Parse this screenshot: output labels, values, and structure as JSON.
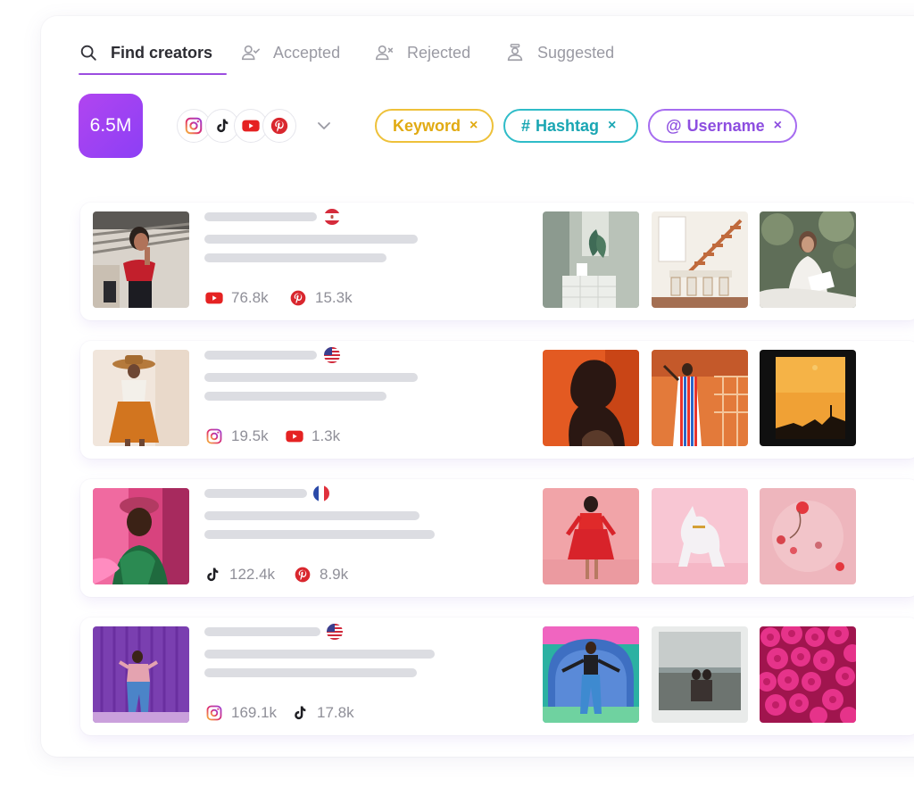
{
  "tabs": [
    {
      "label": "Find creators",
      "icon": "search-icon",
      "active": true
    },
    {
      "label": "Accepted",
      "icon": "user-check-icon",
      "active": false
    },
    {
      "label": "Rejected",
      "icon": "user-x-icon",
      "active": false
    },
    {
      "label": "Suggested",
      "icon": "suggested-user-icon",
      "active": false
    }
  ],
  "count_badge": "6.5M",
  "platforms": [
    "instagram-icon",
    "tiktok-icon",
    "youtube-icon",
    "pinterest-icon"
  ],
  "chips": {
    "keyword": {
      "label": "Keyword",
      "remove": "×"
    },
    "hashtag": {
      "prefix": "#",
      "label": "Hashtag",
      "remove": "×"
    },
    "username": {
      "prefix": "@",
      "label": "Username",
      "remove": "×"
    }
  },
  "colors": {
    "accent": "#9b4de0",
    "badge": "#a041f2",
    "keyword": "#e1aa12",
    "hashtag": "#1aa6b3",
    "username": "#8d4ee0"
  },
  "creators": [
    {
      "flag": "flag-peru-icon",
      "stats": [
        {
          "icon": "youtube-icon",
          "value": "76.8k"
        },
        {
          "icon": "pinterest-icon",
          "value": "15.3k"
        }
      ]
    },
    {
      "flag": "flag-us-icon",
      "stats": [
        {
          "icon": "instagram-icon",
          "value": "19.5k"
        },
        {
          "icon": "youtube-icon",
          "value": "1.3k"
        }
      ]
    },
    {
      "flag": "flag-france-icon",
      "stats": [
        {
          "icon": "tiktok-icon",
          "value": "122.4k"
        },
        {
          "icon": "pinterest-icon",
          "value": "8.9k"
        }
      ]
    },
    {
      "flag": "flag-us-icon",
      "stats": [
        {
          "icon": "instagram-icon",
          "value": "169.1k"
        },
        {
          "icon": "tiktok-icon",
          "value": "17.8k"
        }
      ]
    }
  ]
}
